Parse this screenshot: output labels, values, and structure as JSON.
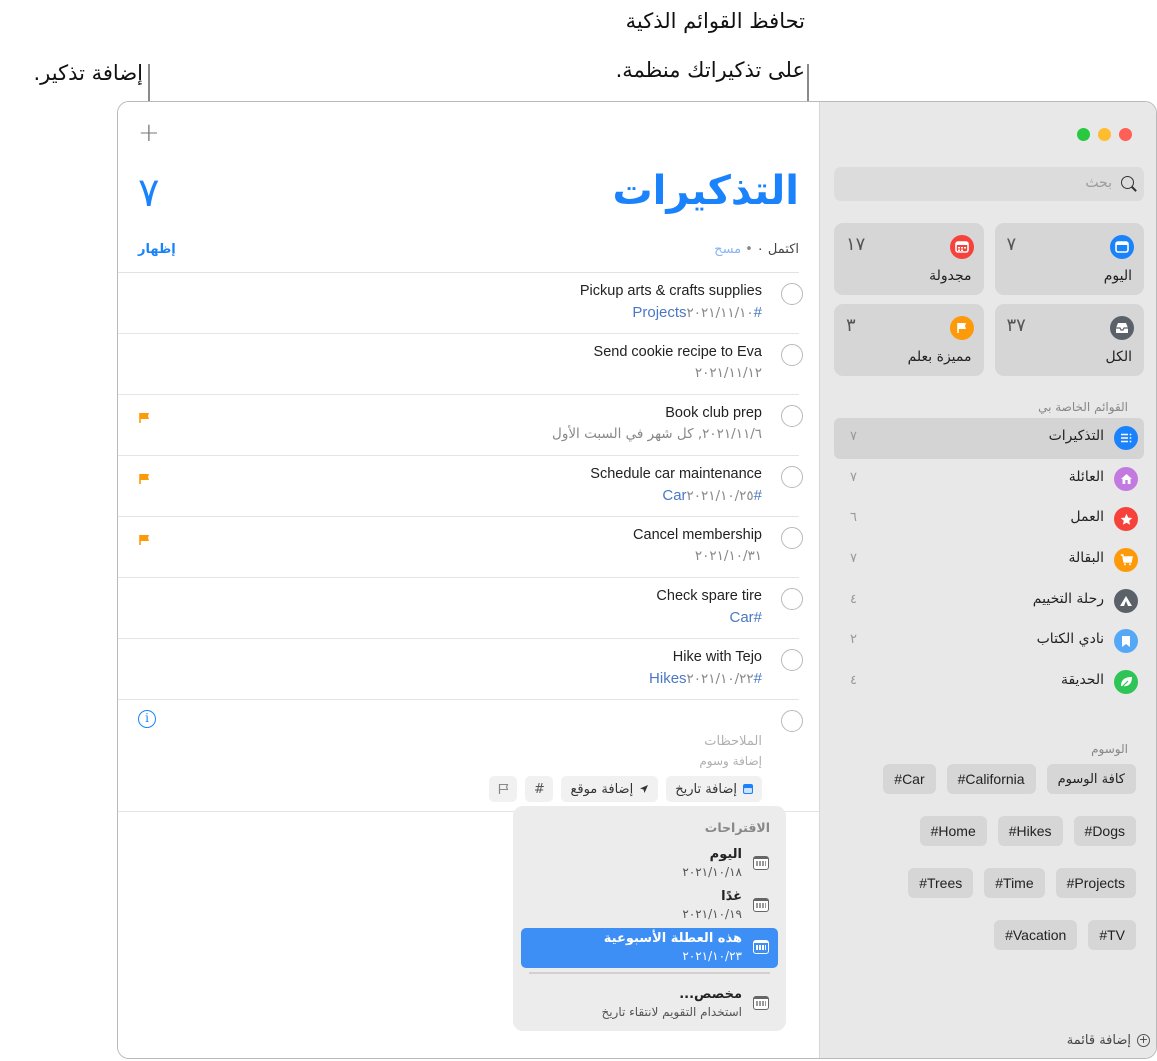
{
  "callouts": {
    "add_reminder": "إضافة تذكير.",
    "smart_lists_line1": "تحافظ القوائم الذكية",
    "smart_lists_line2": "على تذكيراتك منظمة."
  },
  "window": {
    "traffic_lights": {
      "close": "#fe5f57",
      "minimize": "#febc2e",
      "zoom": "#28c840"
    }
  },
  "sidebar": {
    "search_placeholder": "بحث",
    "smart_lists": [
      {
        "label": "اليوم",
        "count": "٧",
        "icon": "calendar-today-icon",
        "color": "#1a82fb"
      },
      {
        "label": "مجدولة",
        "count": "١٧",
        "icon": "calendar-grid-icon",
        "color": "#f6423a"
      },
      {
        "label": "الكل",
        "count": "٣٧",
        "icon": "tray-icon",
        "color": "#5a6169"
      },
      {
        "label": "مميزة بعلم",
        "count": "٣",
        "icon": "flag-icon",
        "color": "#fd9a0a"
      }
    ],
    "my_lists_header": "القوائم الخاصة بي",
    "my_lists": [
      {
        "label": "التذكيرات",
        "count": "٧",
        "icon": "list-icon",
        "color": "#1a82fb",
        "selected": true
      },
      {
        "label": "العائلة",
        "count": "٧",
        "icon": "house-icon",
        "color": "#c27ae0"
      },
      {
        "label": "العمل",
        "count": "٦",
        "icon": "star-icon",
        "color": "#f6423a"
      },
      {
        "label": "البقالة",
        "count": "٧",
        "icon": "cart-icon",
        "color": "#fd9a0a"
      },
      {
        "label": "رحلة التخييم",
        "count": "٤",
        "icon": "tent-icon",
        "color": "#5a6169"
      },
      {
        "label": "نادي الكتاب",
        "count": "٢",
        "icon": "bookmark-icon",
        "color": "#55a8f5"
      },
      {
        "label": "الحديقة",
        "count": "٤",
        "icon": "leaf-icon",
        "color": "#2ec456"
      }
    ],
    "tags_header": "الوسوم",
    "tags_rows": [
      [
        "كافة الوسوم",
        "#California",
        "#Car"
      ],
      [
        "#Dogs",
        "#Hikes",
        "#Home"
      ],
      [
        "#Projects",
        "#Time",
        "#Trees"
      ],
      [
        "#TV",
        "#Vacation"
      ]
    ],
    "add_list_label": "إضافة قائمة"
  },
  "main": {
    "add_button": "+",
    "title": "التذكيرات",
    "count": "٧",
    "completed_label": "اكتمل ٠",
    "clear_label": "مسح",
    "show_label": "إظهار",
    "accent": "#1a82fb",
    "reminders": [
      {
        "title": "Pickup arts & crafts supplies",
        "date": "٢٠٢١/١١/١٠",
        "tag": "#Projects",
        "flagged": false
      },
      {
        "title": "Send cookie recipe to Eva",
        "date": "٢٠٢١/١١/١٢",
        "tag": "",
        "flagged": false
      },
      {
        "title": "Book club prep",
        "date": "٢٠٢١/١١/٦, كل شهر في السبت الأول",
        "tag": "",
        "flagged": true
      },
      {
        "title": "Schedule car maintenance",
        "date": "٢٠٢١/١٠/٢٥",
        "tag": "#Car",
        "flagged": true
      },
      {
        "title": "Cancel membership",
        "date": "٢٠٢١/١٠/٣١",
        "tag": "",
        "flagged": true
      },
      {
        "title": "Check spare tire",
        "date": "",
        "tag": "#Car",
        "flagged": false
      },
      {
        "title": "Hike with Tejo",
        "date": "٢٠٢١/١٠/٢٢",
        "tag": "#Hikes",
        "flagged": false
      }
    ],
    "new_reminder": {
      "notes_placeholder": "الملاحظات",
      "tags_placeholder": "إضافة وسوم",
      "add_date": "إضافة تاريخ",
      "add_location": "إضافة موقع",
      "tag_button": "#"
    },
    "suggestions": {
      "title": "الاقتراحات",
      "items": [
        {
          "name": "اليوم",
          "date": "٢٠٢١/١٠/١٨",
          "active": false
        },
        {
          "name": "غدًا",
          "date": "٢٠٢١/١٠/١٩",
          "active": false
        },
        {
          "name": "هذه العطلة الأسبوعية",
          "date": "٢٠٢١/١٠/٢٣",
          "active": true
        },
        {
          "name": "مخصص...",
          "date": "استخدام التقويم لانتقاء تاريخ",
          "active": false
        }
      ]
    }
  }
}
